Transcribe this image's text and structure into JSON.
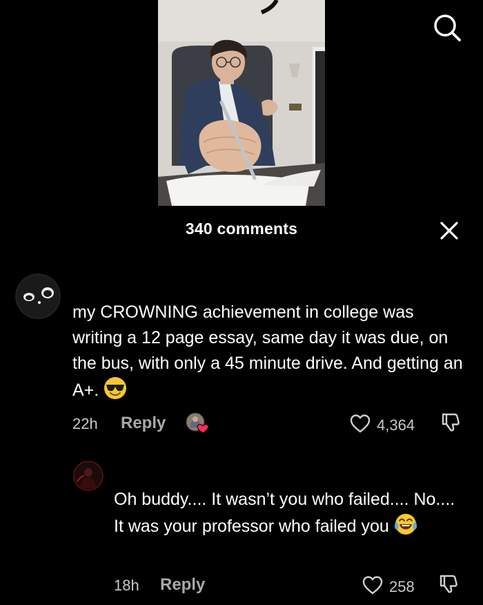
{
  "header": {
    "comments_count_label": "340 comments"
  },
  "icons": {
    "search": "search-icon",
    "close": "close-icon",
    "heart": "heart-icon",
    "dislike": "thumbs-down-icon"
  },
  "comments": [
    {
      "text": "my CROWNING achievement in college was writing a 12 page essay, same day it was due, on the bus, with only a 45 minute drive. And getting an A+.",
      "emoji": "sunglasses-face",
      "time": "22h",
      "reply_label": "Reply",
      "likes": "4,364"
    },
    {
      "text": "Oh buddy.... It wasn’t you who failed.... No.... It was your professor who failed you",
      "emoji": "tears-of-joy-face",
      "time": "18h",
      "reply_label": "Reply",
      "likes": "258"
    }
  ],
  "colors": {
    "background": "#000000",
    "text_primary": "#ffffff",
    "text_secondary": "#c9c9c9",
    "creator_liked_heart": "#fe2c55"
  }
}
